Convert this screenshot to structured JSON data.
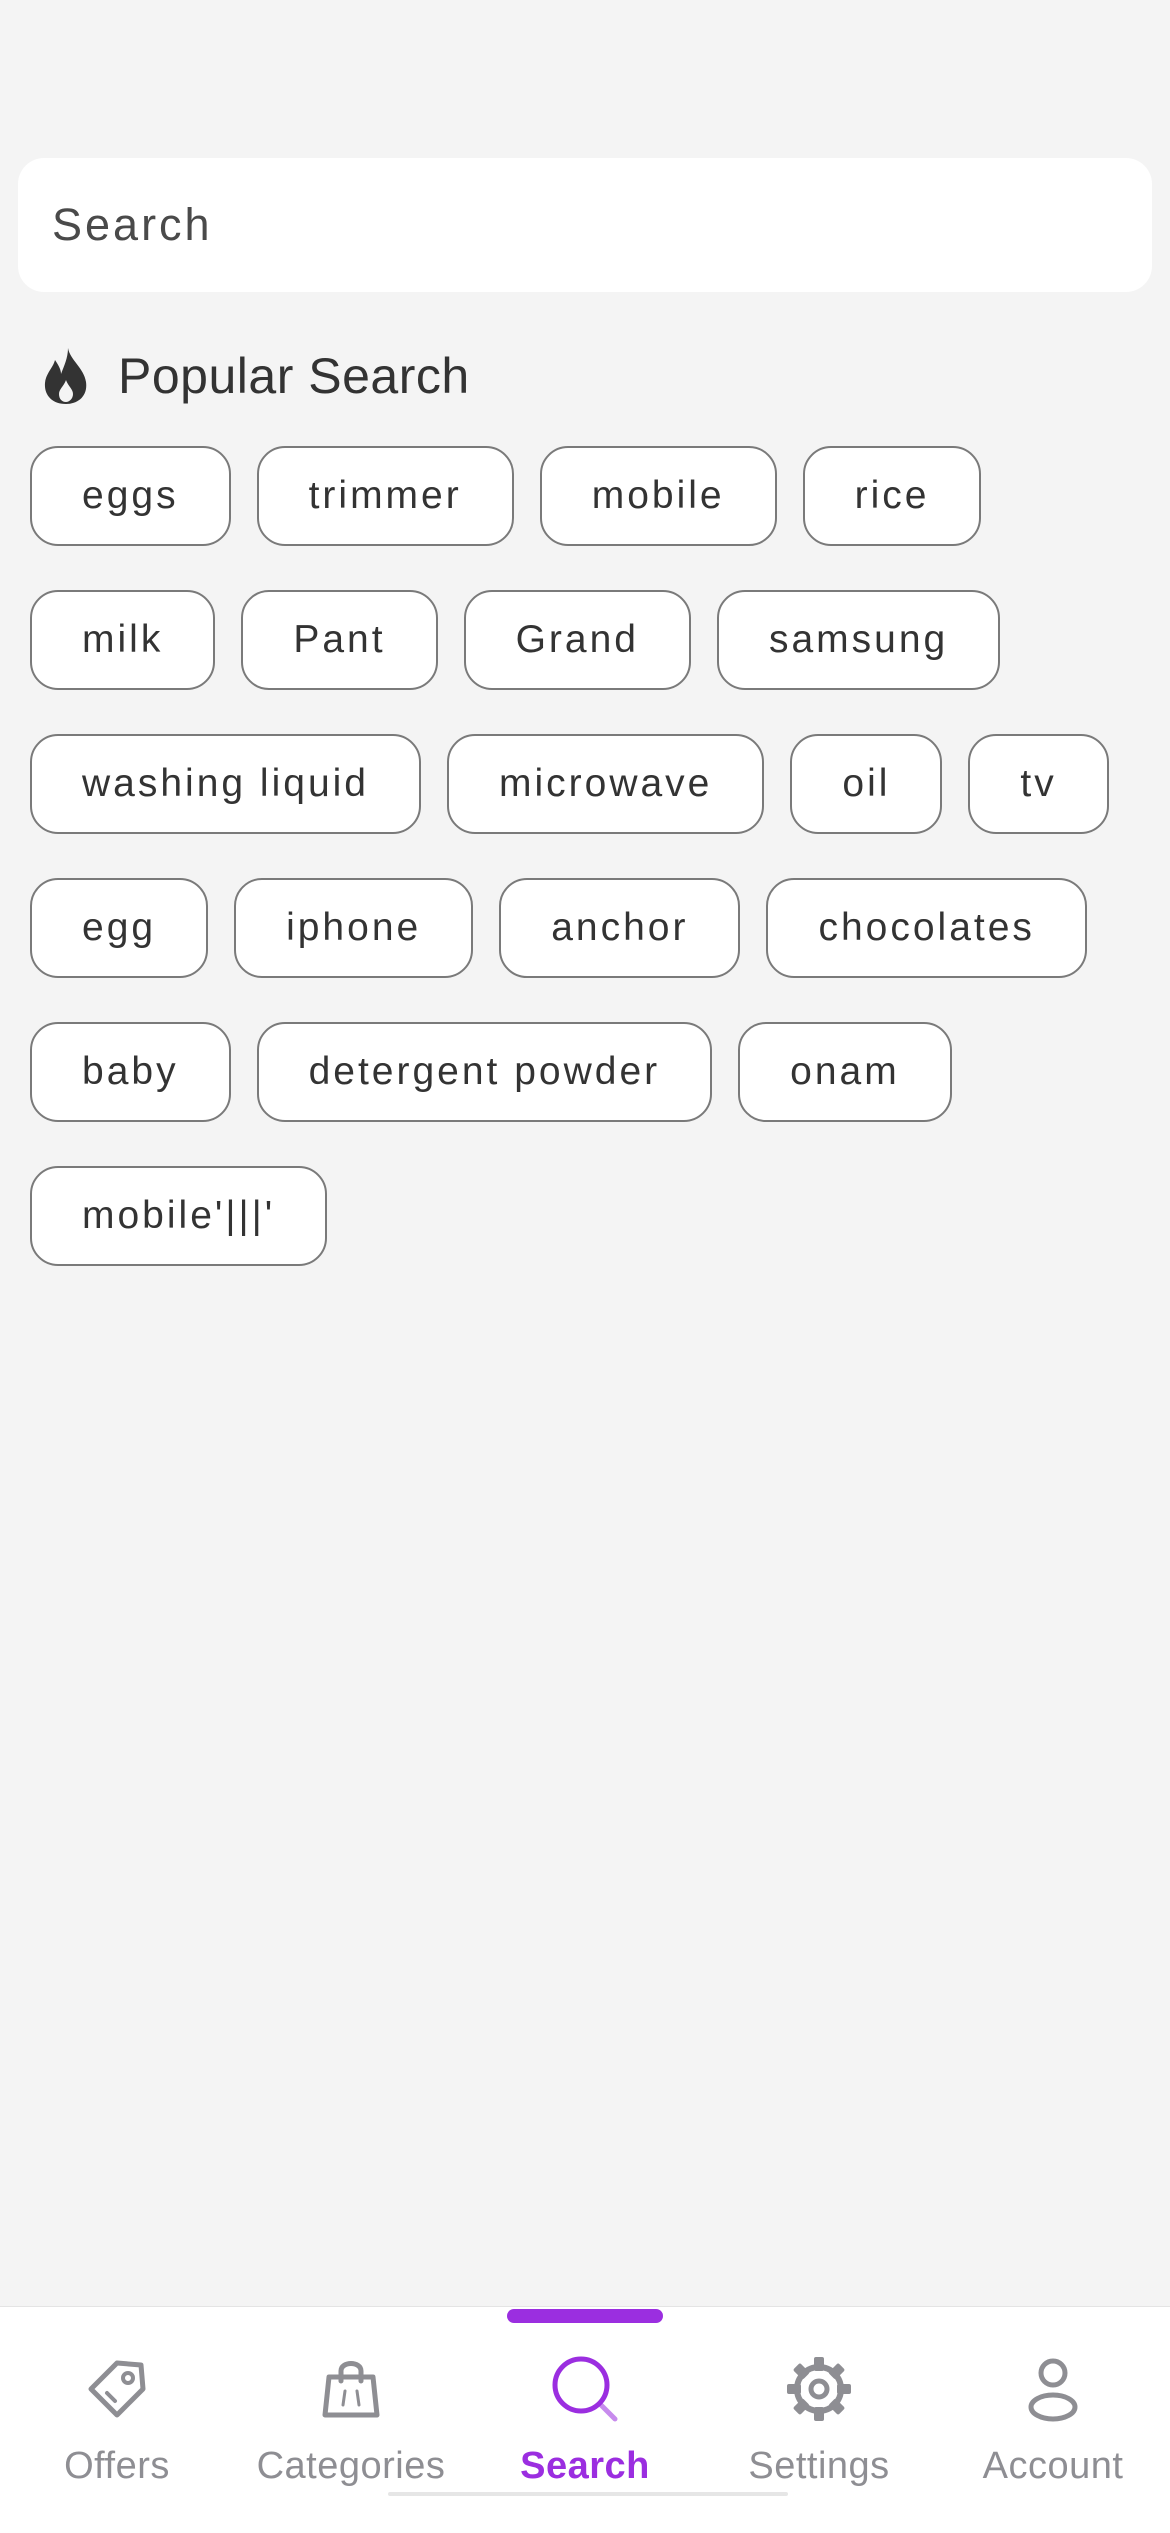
{
  "search": {
    "placeholder": "Search",
    "value": ""
  },
  "popular": {
    "title": "Popular Search",
    "icon": "flame-icon",
    "chips": [
      "eggs",
      "trimmer",
      "mobile",
      "rice",
      "milk",
      "Pant",
      "Grand",
      "samsung",
      "washing liquid",
      "microwave",
      "oil",
      "tv",
      "egg",
      "iphone",
      "anchor",
      "chocolates",
      "baby",
      "detergent powder",
      "onam",
      "mobile'|||'"
    ]
  },
  "tabbar": {
    "active_color": "#9b2ee0",
    "inactive_color": "#8e8e93",
    "active": "search",
    "tabs": [
      {
        "id": "offers",
        "label": "Offers",
        "icon": "tag-icon"
      },
      {
        "id": "categories",
        "label": "Categories",
        "icon": "bag-icon"
      },
      {
        "id": "search",
        "label": "Search",
        "icon": "search-icon"
      },
      {
        "id": "settings",
        "label": "Settings",
        "icon": "gear-icon"
      },
      {
        "id": "account",
        "label": "Account",
        "icon": "person-icon"
      }
    ]
  }
}
